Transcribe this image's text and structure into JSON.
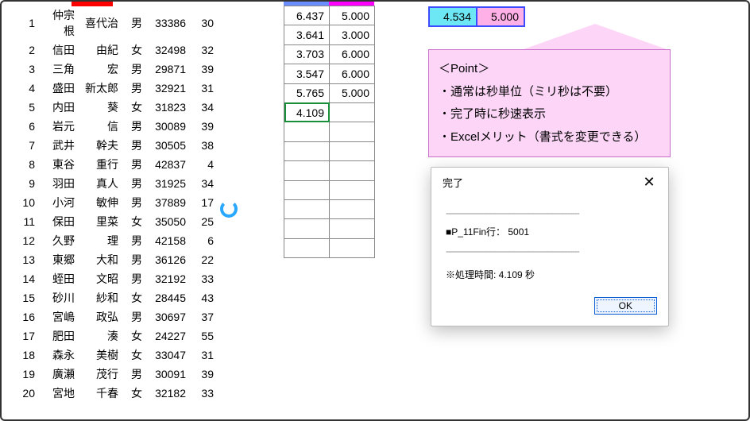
{
  "color_tabs": [
    "red"
  ],
  "rows": [
    {
      "n": 1,
      "sei": "仲宗根",
      "mei": "喜代治",
      "g": "男",
      "code": 33386,
      "age": 30
    },
    {
      "n": 2,
      "sei": "信田",
      "mei": "由紀",
      "g": "女",
      "code": 32498,
      "age": 32
    },
    {
      "n": 3,
      "sei": "三角",
      "mei": "宏",
      "g": "男",
      "code": 29871,
      "age": 39
    },
    {
      "n": 4,
      "sei": "盛田",
      "mei": "新太郎",
      "g": "男",
      "code": 32921,
      "age": 31
    },
    {
      "n": 5,
      "sei": "内田",
      "mei": "葵",
      "g": "女",
      "code": 31823,
      "age": 34
    },
    {
      "n": 6,
      "sei": "岩元",
      "mei": "信",
      "g": "男",
      "code": 30089,
      "age": 39
    },
    {
      "n": 7,
      "sei": "武井",
      "mei": "幹夫",
      "g": "男",
      "code": 30505,
      "age": 38
    },
    {
      "n": 8,
      "sei": "東谷",
      "mei": "重行",
      "g": "男",
      "code": 42837,
      "age": 4
    },
    {
      "n": 9,
      "sei": "羽田",
      "mei": "真人",
      "g": "男",
      "code": 31925,
      "age": 34
    },
    {
      "n": 10,
      "sei": "小河",
      "mei": "敏伸",
      "g": "男",
      "code": 37889,
      "age": 17
    },
    {
      "n": 11,
      "sei": "保田",
      "mei": "里菜",
      "g": "女",
      "code": 35050,
      "age": 25
    },
    {
      "n": 12,
      "sei": "久野",
      "mei": "理",
      "g": "男",
      "code": 42158,
      "age": 6
    },
    {
      "n": 13,
      "sei": "東郷",
      "mei": "大和",
      "g": "男",
      "code": 36126,
      "age": 22
    },
    {
      "n": 14,
      "sei": "蛭田",
      "mei": "文昭",
      "g": "男",
      "code": 32192,
      "age": 33
    },
    {
      "n": 15,
      "sei": "砂川",
      "mei": "紗和",
      "g": "女",
      "code": 28445,
      "age": 43
    },
    {
      "n": 16,
      "sei": "宮嶋",
      "mei": "政弘",
      "g": "男",
      "code": 30697,
      "age": 37
    },
    {
      "n": 17,
      "sei": "肥田",
      "mei": "湊",
      "g": "女",
      "code": 24227,
      "age": 55
    },
    {
      "n": 18,
      "sei": "森永",
      "mei": "美樹",
      "g": "女",
      "code": 33047,
      "age": 31
    },
    {
      "n": 19,
      "sei": "廣瀬",
      "mei": "茂行",
      "g": "男",
      "code": 30091,
      "age": 39
    },
    {
      "n": 20,
      "sei": "宮地",
      "mei": "千春",
      "g": "女",
      "code": 32182,
      "age": 33
    }
  ],
  "grid2": [
    {
      "a": "6.437",
      "b": "5.000"
    },
    {
      "a": "3.641",
      "b": "3.000"
    },
    {
      "a": "3.703",
      "b": "6.000"
    },
    {
      "a": "3.547",
      "b": "6.000"
    },
    {
      "a": "5.765",
      "b": "5.000"
    },
    {
      "a": "4.109",
      "b": ""
    },
    {
      "a": "",
      "b": ""
    },
    {
      "a": "",
      "b": ""
    },
    {
      "a": "",
      "b": ""
    },
    {
      "a": "",
      "b": ""
    },
    {
      "a": "",
      "b": ""
    },
    {
      "a": "",
      "b": ""
    },
    {
      "a": "",
      "b": ""
    }
  ],
  "grid2_selected_row": 5,
  "mini": {
    "a": "4.534",
    "b": "5.000"
  },
  "note": {
    "title": "＜Point＞",
    "lines": [
      "通常は秒単位（ミリ秒は不要）",
      "完了時に秒速表示",
      "Excelメリット（書式を変更できる）"
    ]
  },
  "dialog": {
    "title": "完了",
    "line1": "■P_11Fin行： 5001",
    "line2": "※処理時間: 4.109 秒",
    "ok": "OK"
  }
}
